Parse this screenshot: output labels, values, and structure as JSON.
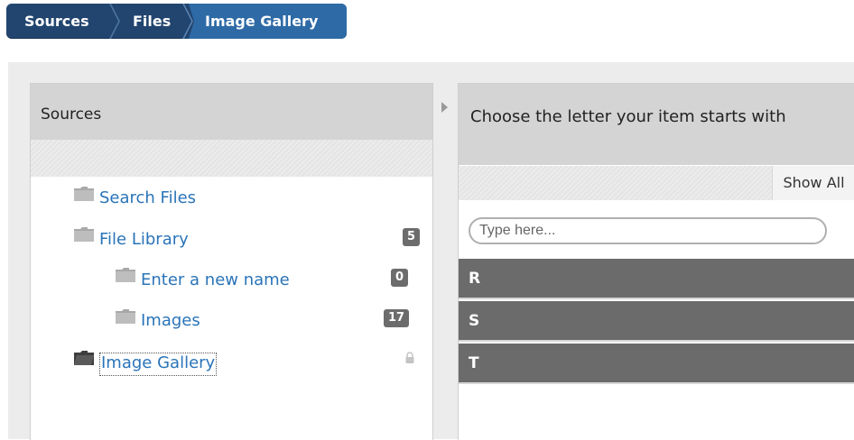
{
  "breadcrumb": {
    "items": [
      "Sources",
      "Files",
      "Image Gallery"
    ]
  },
  "sources_panel": {
    "title": "Sources",
    "tree": [
      {
        "label": "Search Files",
        "badge": ""
      },
      {
        "label": "File Library",
        "badge": "5"
      },
      {
        "label": "Enter a new name",
        "badge": "0"
      },
      {
        "label": "Images",
        "badge": "17"
      },
      {
        "label": "Image Gallery",
        "badge": "",
        "locked": true
      }
    ]
  },
  "letters_panel": {
    "title": "Choose the letter your item starts with",
    "show_all_label": "Show All",
    "search_placeholder": "Type here...",
    "letters": [
      "R",
      "S",
      "T"
    ]
  },
  "colors": {
    "breadcrumb_bg": "#22456f",
    "breadcrumb_active": "#2e6aa6",
    "link": "#2a74b8",
    "letter_row_bg": "#6b6b6b"
  }
}
